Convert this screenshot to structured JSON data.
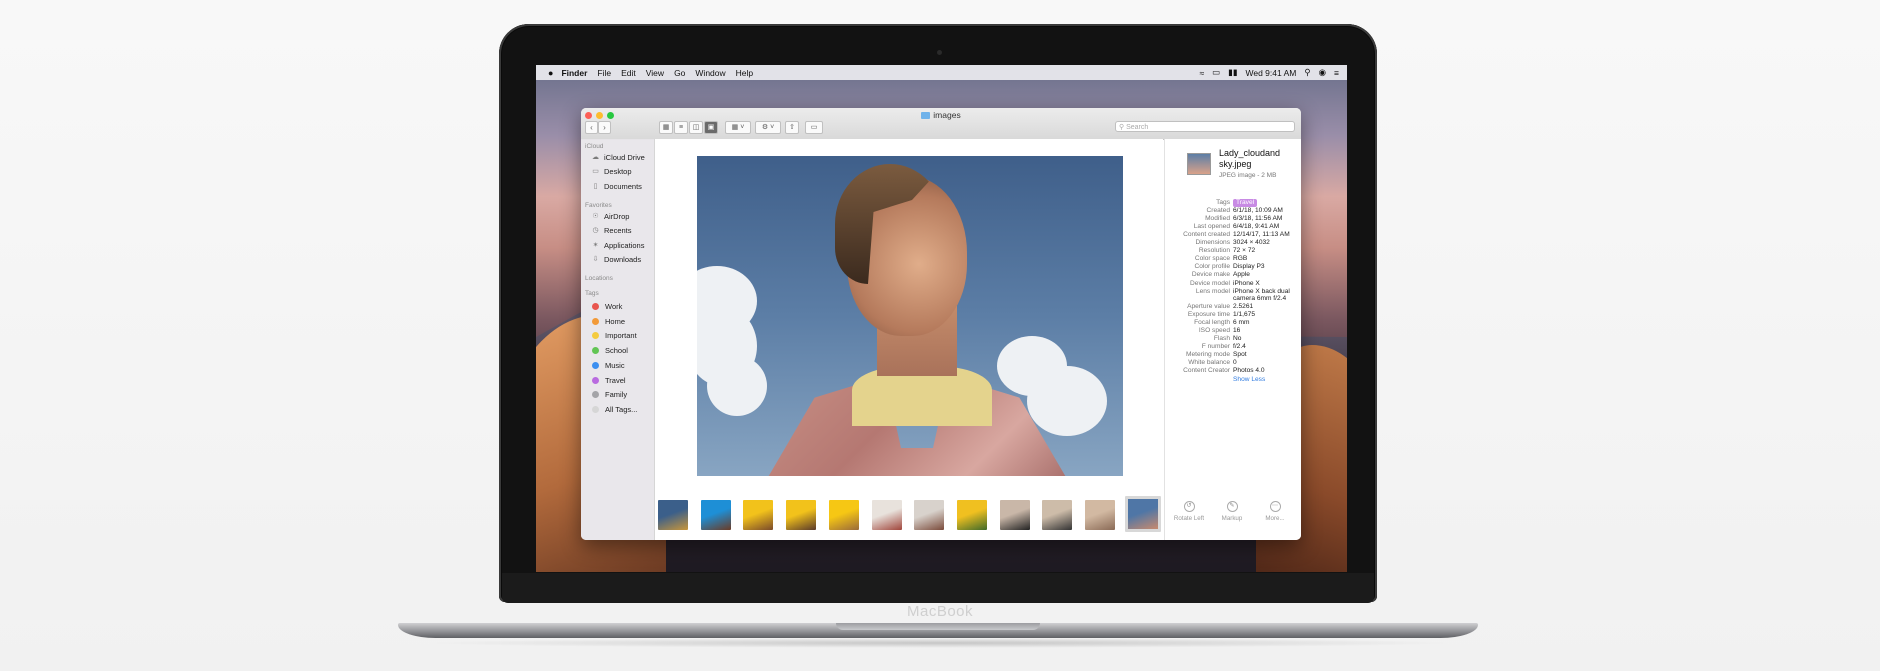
{
  "laptop": {
    "brand": "MacBook"
  },
  "menubar": {
    "items": [
      "Finder",
      "File",
      "Edit",
      "View",
      "Go",
      "Window",
      "Help"
    ],
    "clock": "Wed 9:41 AM"
  },
  "window": {
    "title": "images",
    "search_placeholder": "Search"
  },
  "sidebar": {
    "sections": {
      "icloud": "iCloud",
      "favorites": "Favorites",
      "locations": "Locations",
      "tags": "Tags"
    },
    "icloud": [
      "iCloud Drive",
      "Desktop",
      "Documents"
    ],
    "favorites": [
      "AirDrop",
      "Recents",
      "Applications",
      "Downloads"
    ],
    "tags": [
      {
        "label": "Work",
        "color": "#e8554e"
      },
      {
        "label": "Home",
        "color": "#f29a38"
      },
      {
        "label": "Important",
        "color": "#f4cb3f"
      },
      {
        "label": "School",
        "color": "#62c554"
      },
      {
        "label": "Music",
        "color": "#3c8ff0"
      },
      {
        "label": "Travel",
        "color": "#b96be0"
      },
      {
        "label": "Family",
        "color": "#a4a4a8"
      },
      {
        "label": "All Tags...",
        "color": "#d6d6d6"
      }
    ]
  },
  "inspector": {
    "file_name": "Lady_cloudand sky.jpeg",
    "file_kind": "JPEG image - 2 MB",
    "tag_value": "Travel",
    "rows": [
      {
        "key": "Tags",
        "value": ""
      },
      {
        "key": "Created",
        "value": "6/1/18, 10:09 AM"
      },
      {
        "key": "Modified",
        "value": "6/3/18, 11:56 AM"
      },
      {
        "key": "Last opened",
        "value": "6/4/18, 9:41 AM"
      },
      {
        "key": "Content created",
        "value": "12/14/17, 11:13 AM"
      },
      {
        "key": "Dimensions",
        "value": "3024 × 4032"
      },
      {
        "key": "Resolution",
        "value": "72 × 72"
      },
      {
        "key": "Color space",
        "value": "RGB"
      },
      {
        "key": "Color profile",
        "value": "Display P3"
      },
      {
        "key": "Device make",
        "value": "Apple"
      },
      {
        "key": "Device model",
        "value": "iPhone X"
      },
      {
        "key": "Lens model",
        "value": "iPhone X back dual camera 6mm f/2.4"
      },
      {
        "key": "Aperture value",
        "value": "2.5261"
      },
      {
        "key": "Exposure time",
        "value": "1/1,675"
      },
      {
        "key": "Focal length",
        "value": "6 mm"
      },
      {
        "key": "ISO speed",
        "value": "16"
      },
      {
        "key": "Flash",
        "value": "No"
      },
      {
        "key": "F number",
        "value": "f/2.4"
      },
      {
        "key": "Metering mode",
        "value": "Spot"
      },
      {
        "key": "White balance",
        "value": "0"
      },
      {
        "key": "Content Creator",
        "value": "Photos 4.0"
      }
    ],
    "show_less": "Show Less",
    "actions": [
      "Rotate Left",
      "Markup",
      "More..."
    ]
  },
  "colors": {
    "accent": "#2f7be0",
    "traffic_close": "#fd5f57",
    "traffic_min": "#fdbc2e",
    "traffic_max": "#28c840"
  },
  "thumbnails": [
    {
      "c1": "#3b5f8a",
      "c2": "#c8963a"
    },
    {
      "c1": "#1e8fd6",
      "c2": "#6b3b25"
    },
    {
      "c1": "#f2c21b",
      "c2": "#7a4a2a"
    },
    {
      "c1": "#f2c21b",
      "c2": "#5a3a2a"
    },
    {
      "c1": "#f6c714",
      "c2": "#9a6a3a"
    },
    {
      "c1": "#e8e2dc",
      "c2": "#a0443a"
    },
    {
      "c1": "#d8d2cc",
      "c2": "#7a4a3a"
    },
    {
      "c1": "#f0c020",
      "c2": "#3f6a2a"
    },
    {
      "c1": "#c9b7a8",
      "c2": "#222222"
    },
    {
      "c1": "#cdbca9",
      "c2": "#333333"
    },
    {
      "c1": "#d2b9a2",
      "c2": "#8a6a56"
    },
    {
      "c1": "#4f76a6",
      "c2": "#c88a6e"
    }
  ]
}
